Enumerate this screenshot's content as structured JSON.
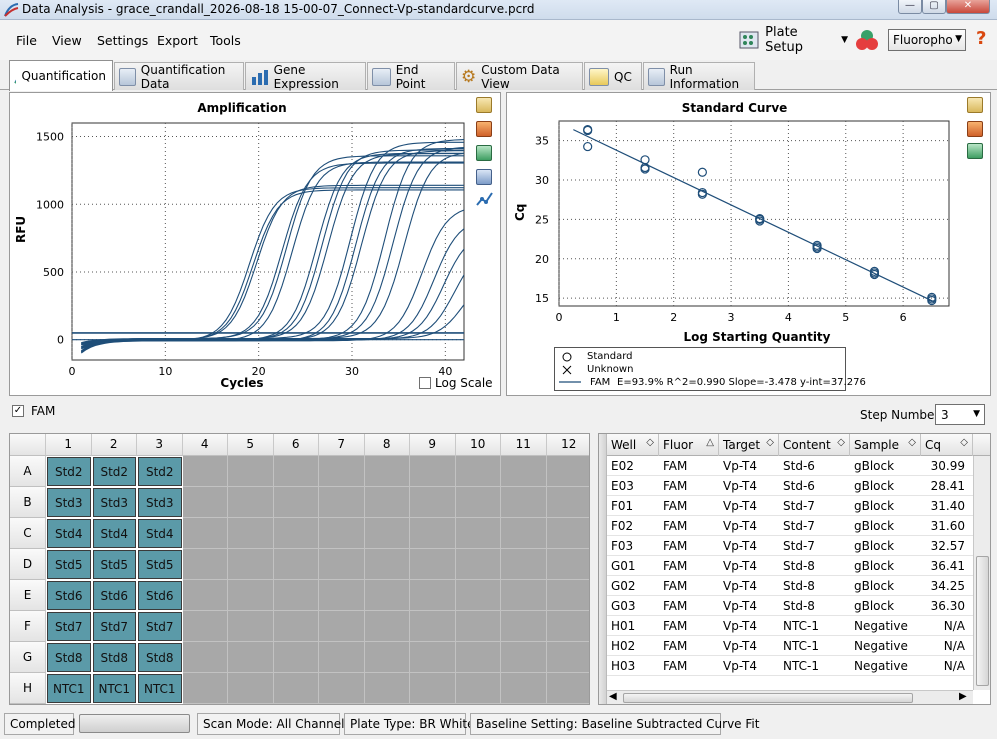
{
  "window": {
    "title": "Data Analysis - grace_crandall_2026-08-18 15-00-07_Connect-Vp-standardcurve.pcrd"
  },
  "menu": {
    "items": [
      "File",
      "View",
      "Settings",
      "Export",
      "Tools"
    ]
  },
  "toolbar": {
    "plate_setup": "Plate Setup",
    "fluorophore": "Fluoropho",
    "help": "?"
  },
  "tabs": [
    "Quantification",
    "Quantification Data",
    "Gene Expression",
    "End Point",
    "Custom Data View",
    "QC",
    "Run Information"
  ],
  "amplification": {
    "title": "Amplification",
    "xlabel": "Cycles",
    "ylabel": "RFU",
    "xticks": [
      "0",
      "10",
      "20",
      "30",
      "40"
    ],
    "yticks": [
      "0",
      "500",
      "1000",
      "1500"
    ],
    "log_scale_label": "Log Scale"
  },
  "standard_curve": {
    "title": "Standard Curve",
    "xlabel": "Log Starting Quantity",
    "ylabel": "Cq",
    "xticks": [
      "0",
      "1",
      "2",
      "3",
      "4",
      "5",
      "6"
    ],
    "yticks": [
      "15",
      "20",
      "25",
      "30",
      "35"
    ],
    "legend": {
      "standard": "Standard",
      "unknown": "Unknown",
      "fam_line": "FAM",
      "fam_stats": "E=93.9% R^2=0.990 Slope=-3.478 y-int=37.276"
    }
  },
  "chart_data": [
    {
      "type": "line",
      "title": "Amplification",
      "xlabel": "Cycles",
      "ylabel": "RFU",
      "xlim": [
        0,
        42
      ],
      "ylim": [
        -150,
        1600
      ],
      "grid": true,
      "series": [
        {
          "midpoint": 19.0,
          "plateau": 1130
        },
        {
          "midpoint": 19.4,
          "plateau": 1110
        },
        {
          "midpoint": 19.8,
          "plateau": 1140
        },
        {
          "midpoint": 22.5,
          "plateau": 1300
        },
        {
          "midpoint": 23.0,
          "plateau": 1350
        },
        {
          "midpoint": 23.6,
          "plateau": 1320
        },
        {
          "midpoint": 26.2,
          "plateau": 1380
        },
        {
          "midpoint": 26.8,
          "plateau": 1400
        },
        {
          "midpoint": 27.4,
          "plateau": 1370
        },
        {
          "midpoint": 29.8,
          "plateau": 1450
        },
        {
          "midpoint": 30.4,
          "plateau": 1420
        },
        {
          "midpoint": 31.0,
          "plateau": 1400
        },
        {
          "midpoint": 33.5,
          "plateau": 1480
        },
        {
          "midpoint": 34.4,
          "plateau": 1420
        },
        {
          "midpoint": 35.6,
          "plateau": 1380
        },
        {
          "midpoint": 37.5,
          "plateau": 1000
        },
        {
          "midpoint": 38.8,
          "plateau": 900
        },
        {
          "midpoint": 39.8,
          "plateau": 800
        },
        {
          "midpoint": 41.0,
          "plateau": 700
        },
        {
          "midpoint": 42.0,
          "plateau": 500
        }
      ],
      "threshold": 50
    },
    {
      "type": "scatter",
      "title": "Standard Curve",
      "xlabel": "Log Starting Quantity",
      "ylabel": "Cq",
      "xlim": [
        0,
        6.8
      ],
      "ylim": [
        14,
        37.5
      ],
      "grid": true,
      "points": [
        {
          "x": 0.5,
          "y": 36.41
        },
        {
          "x": 0.5,
          "y": 34.25
        },
        {
          "x": 0.5,
          "y": 36.3
        },
        {
          "x": 1.5,
          "y": 31.4
        },
        {
          "x": 1.5,
          "y": 31.6
        },
        {
          "x": 1.5,
          "y": 32.57
        },
        {
          "x": 2.5,
          "y": 30.99
        },
        {
          "x": 2.5,
          "y": 28.41
        },
        {
          "x": 2.5,
          "y": 28.2
        },
        {
          "x": 3.5,
          "y": 25.1
        },
        {
          "x": 3.5,
          "y": 24.8
        },
        {
          "x": 3.5,
          "y": 25.0
        },
        {
          "x": 4.5,
          "y": 21.7
        },
        {
          "x": 4.5,
          "y": 21.3
        },
        {
          "x": 4.5,
          "y": 21.5
        },
        {
          "x": 5.5,
          "y": 18.4
        },
        {
          "x": 5.5,
          "y": 18.0
        },
        {
          "x": 5.5,
          "y": 18.2
        },
        {
          "x": 6.5,
          "y": 15.1
        },
        {
          "x": 6.5,
          "y": 14.7
        },
        {
          "x": 6.5,
          "y": 14.9
        }
      ],
      "fit": {
        "slope": -3.478,
        "intercept": 37.276
      }
    }
  ],
  "fluor_bar": {
    "fam_label": "FAM",
    "step_label": "Step Number:",
    "step_value": "3"
  },
  "plate": {
    "columns": [
      "1",
      "2",
      "3",
      "4",
      "5",
      "6",
      "7",
      "8",
      "9",
      "10",
      "11",
      "12"
    ],
    "rows": [
      {
        "label": "A",
        "wells": [
          "Std2",
          "Std2",
          "Std2"
        ]
      },
      {
        "label": "B",
        "wells": [
          "Std3",
          "Std3",
          "Std3"
        ]
      },
      {
        "label": "C",
        "wells": [
          "Std4",
          "Std4",
          "Std4"
        ]
      },
      {
        "label": "D",
        "wells": [
          "Std5",
          "Std5",
          "Std5"
        ]
      },
      {
        "label": "E",
        "wells": [
          "Std6",
          "Std6",
          "Std6"
        ]
      },
      {
        "label": "F",
        "wells": [
          "Std7",
          "Std7",
          "Std7"
        ]
      },
      {
        "label": "G",
        "wells": [
          "Std8",
          "Std8",
          "Std8"
        ]
      },
      {
        "label": "H",
        "wells": [
          "NTC1",
          "NTC1",
          "NTC1"
        ]
      }
    ]
  },
  "table": {
    "headers": [
      "Well",
      "Fluor",
      "Target",
      "Content",
      "Sample",
      "Cq"
    ],
    "rows": [
      [
        "E02",
        "FAM",
        "Vp-T4",
        "Std-6",
        "gBlock",
        "30.99"
      ],
      [
        "E03",
        "FAM",
        "Vp-T4",
        "Std-6",
        "gBlock",
        "28.41"
      ],
      [
        "F01",
        "FAM",
        "Vp-T4",
        "Std-7",
        "gBlock",
        "31.40"
      ],
      [
        "F02",
        "FAM",
        "Vp-T4",
        "Std-7",
        "gBlock",
        "31.60"
      ],
      [
        "F03",
        "FAM",
        "Vp-T4",
        "Std-7",
        "gBlock",
        "32.57"
      ],
      [
        "G01",
        "FAM",
        "Vp-T4",
        "Std-8",
        "gBlock",
        "36.41"
      ],
      [
        "G02",
        "FAM",
        "Vp-T4",
        "Std-8",
        "gBlock",
        "34.25"
      ],
      [
        "G03",
        "FAM",
        "Vp-T4",
        "Std-8",
        "gBlock",
        "36.30"
      ],
      [
        "H01",
        "FAM",
        "Vp-T4",
        "NTC-1",
        "Negative",
        "N/A"
      ],
      [
        "H02",
        "FAM",
        "Vp-T4",
        "NTC-1",
        "Negative",
        "N/A"
      ],
      [
        "H03",
        "FAM",
        "Vp-T4",
        "NTC-1",
        "Negative",
        "N/A"
      ]
    ]
  },
  "statusbar": {
    "completed": "Completed",
    "scan_mode": "Scan Mode: All Channels",
    "plate_type": "Plate Type: BR White",
    "baseline": "Baseline Setting: Baseline Subtracted Curve Fit"
  },
  "colors": {
    "curve": "#1f4e79",
    "well": "#5b9aa8",
    "empty_well": "#a8a8a8"
  }
}
